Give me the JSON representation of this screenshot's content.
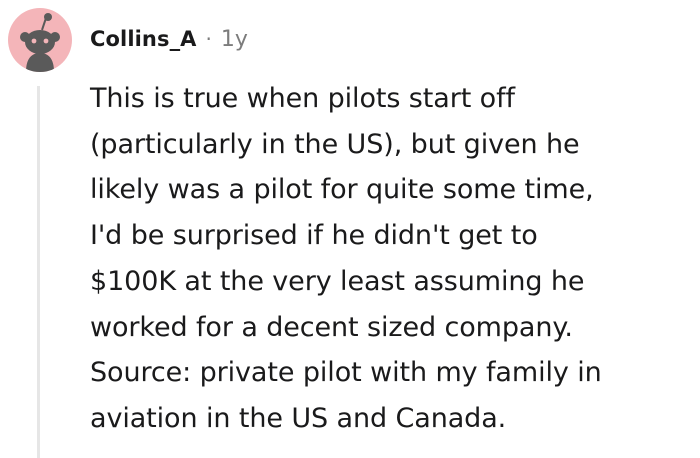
{
  "comment": {
    "username": "Collins_A",
    "separator": "·",
    "age": "1y",
    "lines": [
      "This is true when pilots start off",
      "(particularly in the US), but given he",
      "likely was a pilot for quite some time,",
      "I'd be surprised if he didn't get to",
      "$100K at the very least assuming he",
      "worked for a decent sized company.",
      "Source: private pilot with my family in",
      "aviation in the US and Canada."
    ]
  },
  "avatar": {
    "icon": "snoo-avatar-icon",
    "background_color": "#f4b5b9",
    "figure_color": "#5a5a5a"
  },
  "colors": {
    "text": "#1a1a1b",
    "meta": "#7c7c7c",
    "thread_line": "#e6e6e6"
  }
}
